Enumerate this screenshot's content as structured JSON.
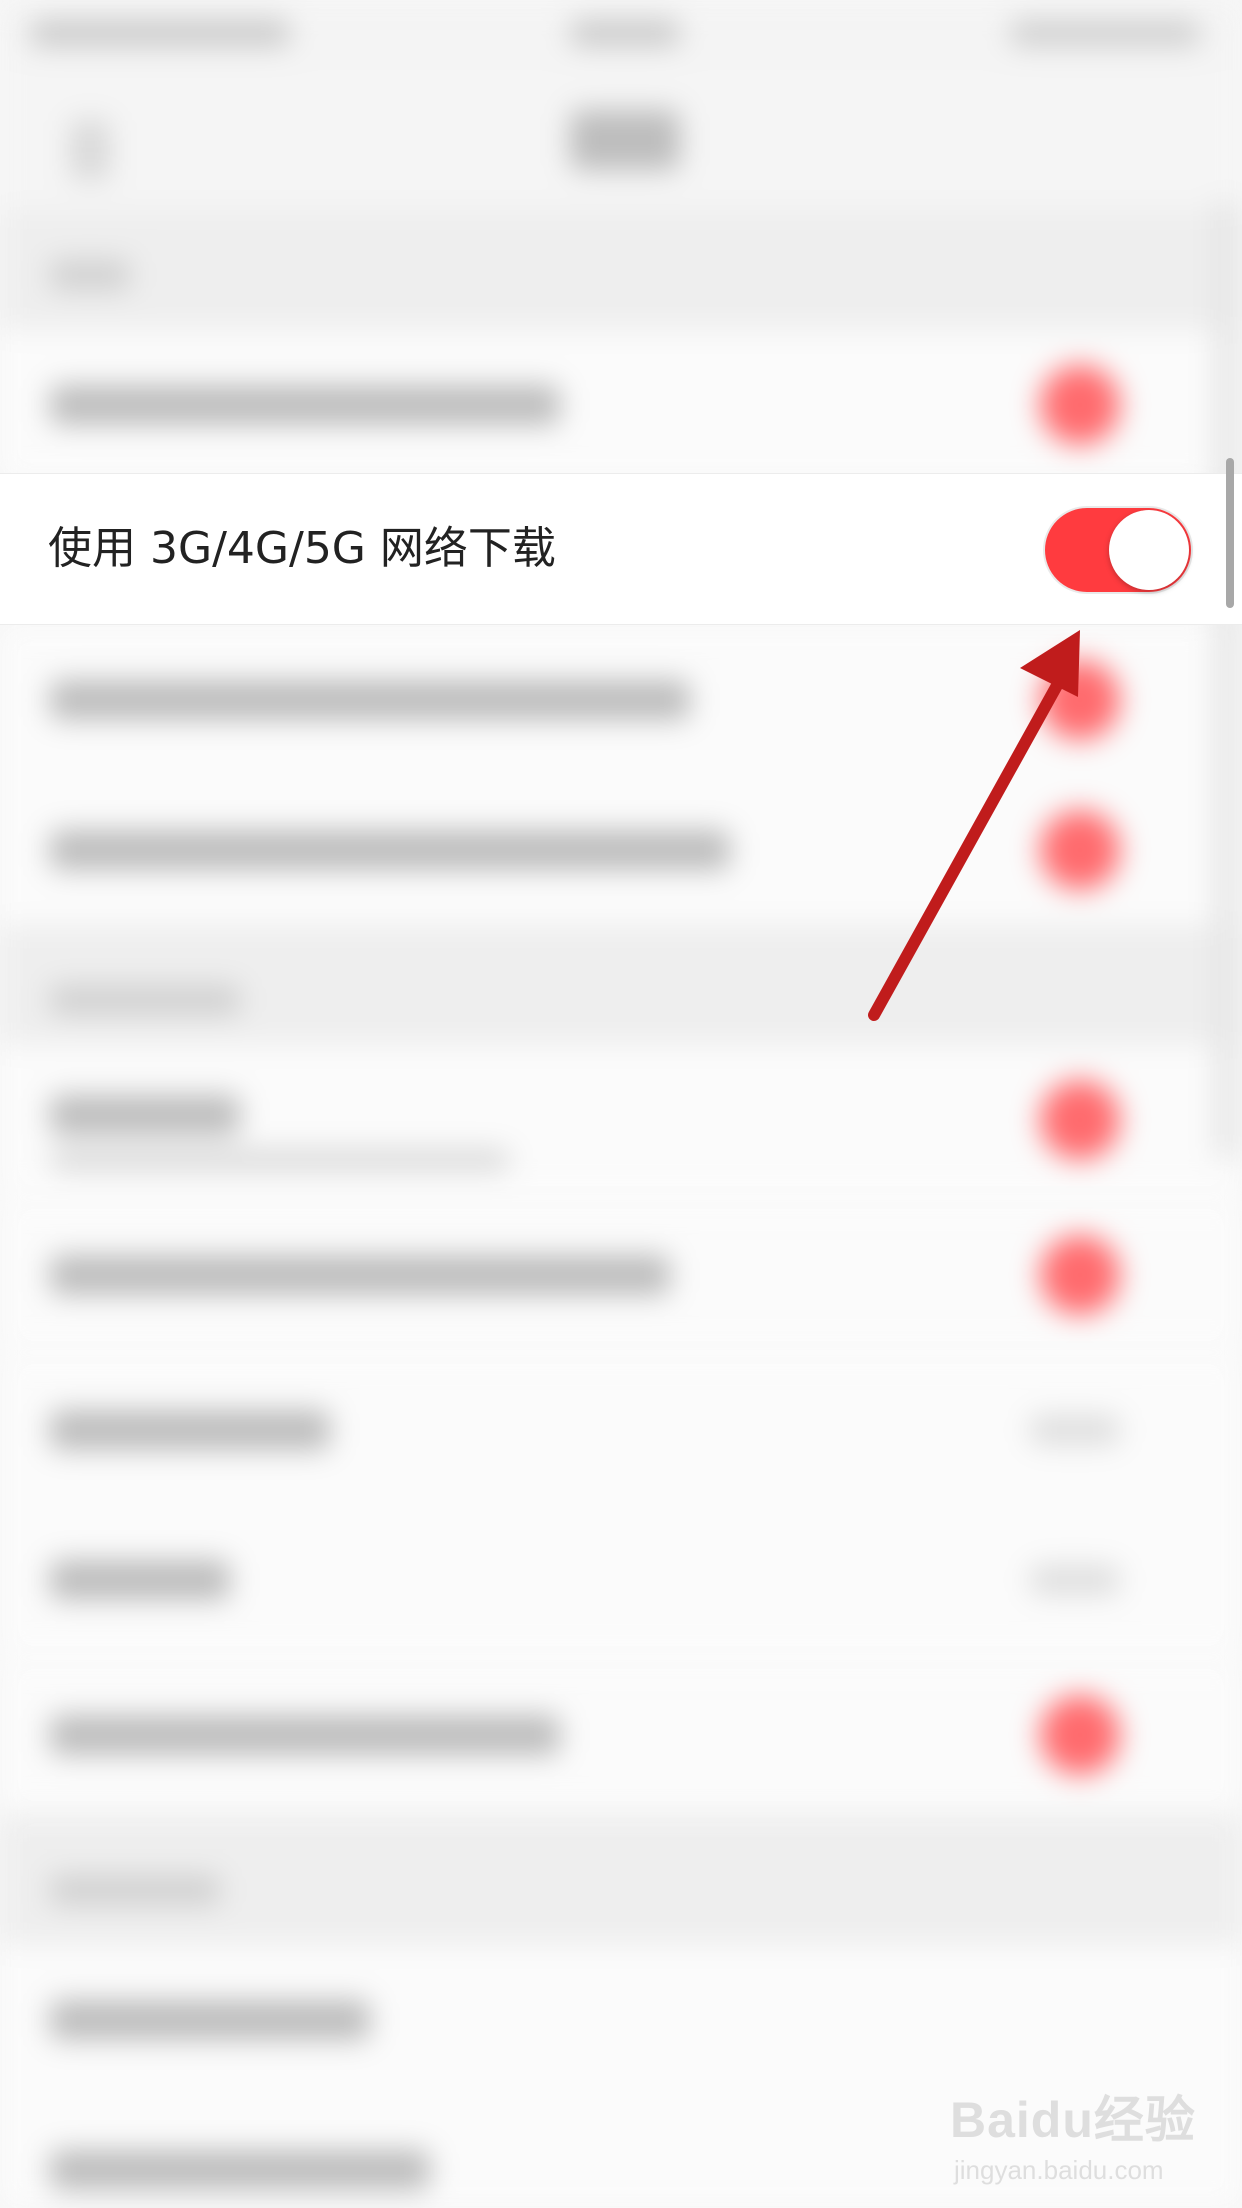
{
  "setting_row": {
    "label": "使用 3G/4G/5G 网络下载",
    "toggle_state": "on"
  },
  "colors": {
    "toggle_on": "#ff3b3f",
    "annotation_arrow": "#c01c1c"
  },
  "watermark": {
    "logo": "Baidu经验",
    "url": "jingyan.baidu.com"
  }
}
